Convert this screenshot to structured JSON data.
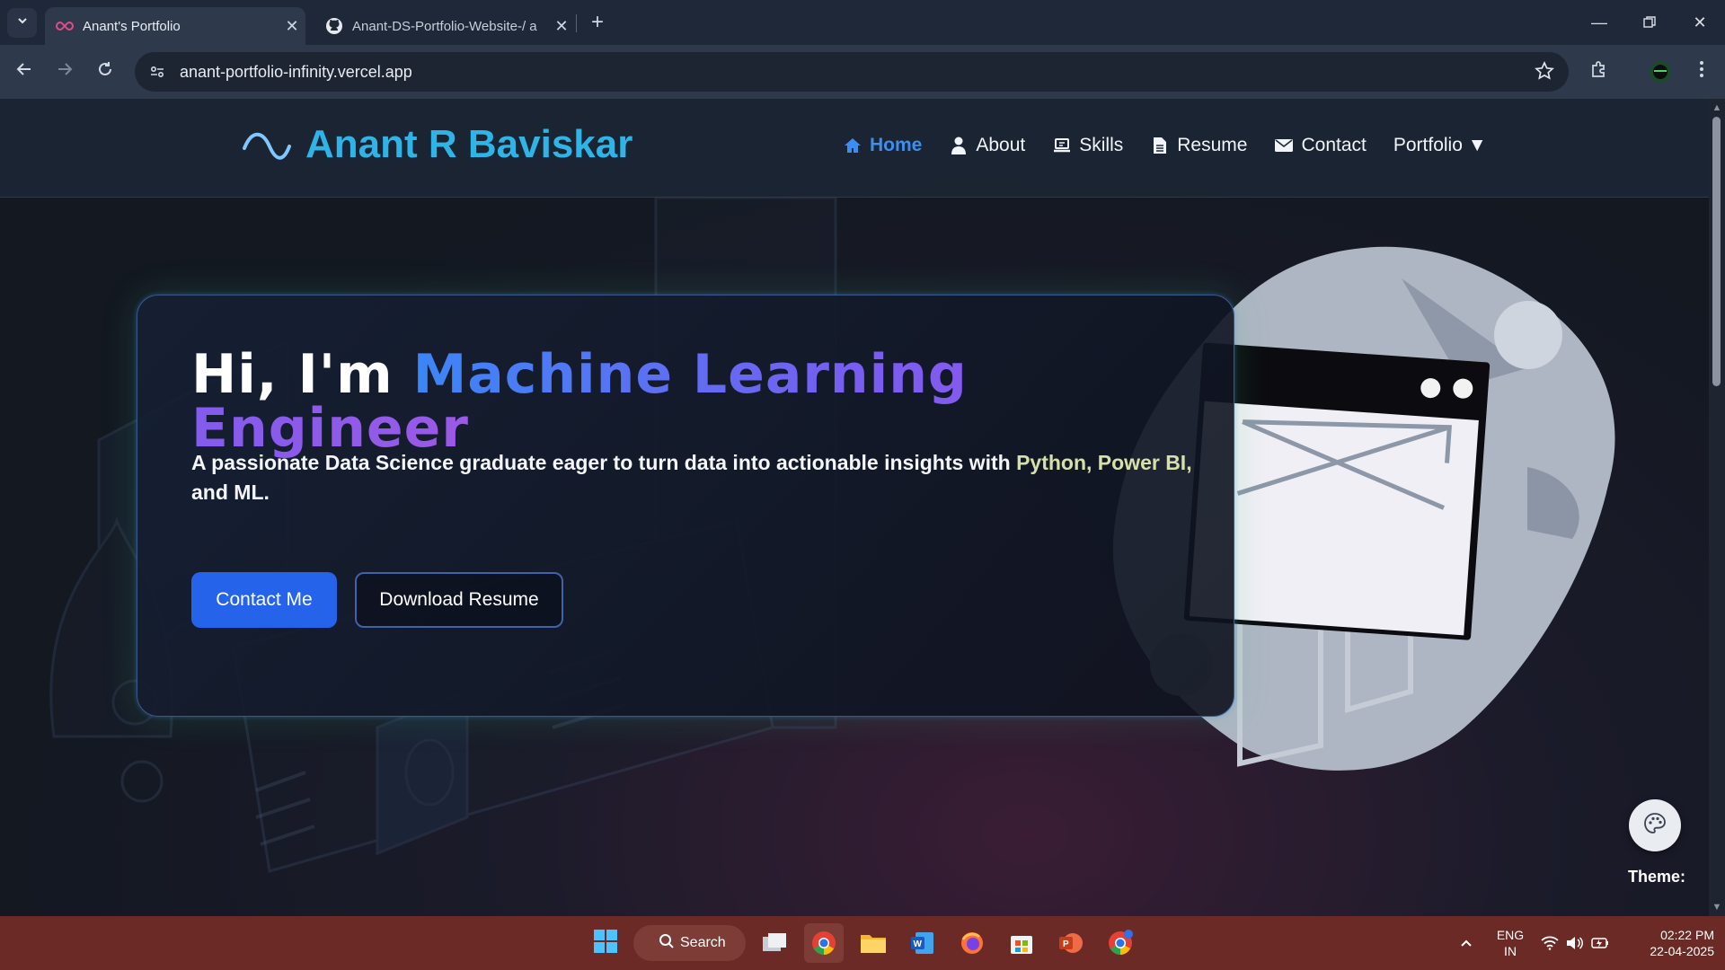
{
  "browser": {
    "tabs": [
      {
        "title": "Anant's Portfolio",
        "active": true
      },
      {
        "title": "Anant-DS-Portfolio-Website-/ a",
        "active": false
      }
    ],
    "url": "anant-portfolio-infinity.vercel.app"
  },
  "navbar": {
    "brand": "Anant R Baviskar",
    "links": [
      {
        "label": "Home",
        "icon": "home-icon",
        "active": true
      },
      {
        "label": "About",
        "icon": "user-icon",
        "active": false
      },
      {
        "label": "Skills",
        "icon": "laptop-icon",
        "active": false
      },
      {
        "label": "Resume",
        "icon": "file-icon",
        "active": false
      },
      {
        "label": "Contact",
        "icon": "envelope-icon",
        "active": false
      },
      {
        "label": "Portfolio ▼",
        "icon": "",
        "active": false
      }
    ]
  },
  "hero": {
    "greeting": "Hi, I'm",
    "role": "Machine Learning Engineer",
    "description_pre": "A passionate Data Science graduate eager to turn data into actionable insights with ",
    "description_highlight": "Python, Power BI,",
    "description_post": " and ML.",
    "contact_button": "Contact Me",
    "resume_button": "Download Resume"
  },
  "theme": {
    "label": "Theme:"
  },
  "taskbar": {
    "search_label": "Search",
    "language": "ENG",
    "region": "IN",
    "time": "02:22 PM",
    "date": "22-04-2025"
  },
  "colors": {
    "accent_blue": "#2563eb",
    "brand_cyan": "#2fb4e8",
    "nav_active": "#3a8ff0",
    "taskbar": "#6b2a25"
  }
}
